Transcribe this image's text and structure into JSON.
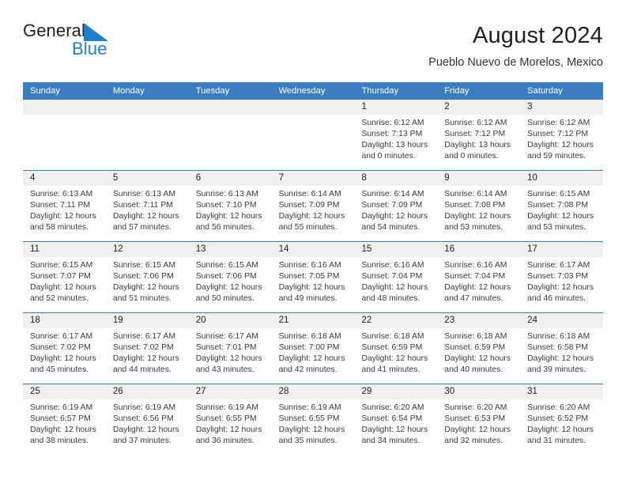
{
  "brand": {
    "name_primary": "General",
    "name_secondary": "Blue",
    "triangle_icon": "blue-triangle-logo-icon",
    "accent_color": "#1c7fd1"
  },
  "header": {
    "title": "August 2024",
    "subtitle": "Pueblo Nuevo de Morelos, Mexico"
  },
  "colors": {
    "header_blue": "#3a7dc0",
    "date_band_gray": "#f0f0f0",
    "text": "#3b3b3b"
  },
  "weekdays": [
    "Sunday",
    "Monday",
    "Tuesday",
    "Wednesday",
    "Thursday",
    "Friday",
    "Saturday"
  ],
  "weeks": [
    [
      {
        "day": "",
        "sunrise": "",
        "sunset": "",
        "daylight_1": "",
        "daylight_2": ""
      },
      {
        "day": "",
        "sunrise": "",
        "sunset": "",
        "daylight_1": "",
        "daylight_2": ""
      },
      {
        "day": "",
        "sunrise": "",
        "sunset": "",
        "daylight_1": "",
        "daylight_2": ""
      },
      {
        "day": "",
        "sunrise": "",
        "sunset": "",
        "daylight_1": "",
        "daylight_2": ""
      },
      {
        "day": "1",
        "sunrise": "Sunrise: 6:12 AM",
        "sunset": "Sunset: 7:13 PM",
        "daylight_1": "Daylight: 13 hours",
        "daylight_2": "and 0 minutes."
      },
      {
        "day": "2",
        "sunrise": "Sunrise: 6:12 AM",
        "sunset": "Sunset: 7:12 PM",
        "daylight_1": "Daylight: 13 hours",
        "daylight_2": "and 0 minutes."
      },
      {
        "day": "3",
        "sunrise": "Sunrise: 6:12 AM",
        "sunset": "Sunset: 7:12 PM",
        "daylight_1": "Daylight: 12 hours",
        "daylight_2": "and 59 minutes."
      }
    ],
    [
      {
        "day": "4",
        "sunrise": "Sunrise: 6:13 AM",
        "sunset": "Sunset: 7:11 PM",
        "daylight_1": "Daylight: 12 hours",
        "daylight_2": "and 58 minutes."
      },
      {
        "day": "5",
        "sunrise": "Sunrise: 6:13 AM",
        "sunset": "Sunset: 7:11 PM",
        "daylight_1": "Daylight: 12 hours",
        "daylight_2": "and 57 minutes."
      },
      {
        "day": "6",
        "sunrise": "Sunrise: 6:13 AM",
        "sunset": "Sunset: 7:10 PM",
        "daylight_1": "Daylight: 12 hours",
        "daylight_2": "and 56 minutes."
      },
      {
        "day": "7",
        "sunrise": "Sunrise: 6:14 AM",
        "sunset": "Sunset: 7:09 PM",
        "daylight_1": "Daylight: 12 hours",
        "daylight_2": "and 55 minutes."
      },
      {
        "day": "8",
        "sunrise": "Sunrise: 6:14 AM",
        "sunset": "Sunset: 7:09 PM",
        "daylight_1": "Daylight: 12 hours",
        "daylight_2": "and 54 minutes."
      },
      {
        "day": "9",
        "sunrise": "Sunrise: 6:14 AM",
        "sunset": "Sunset: 7:08 PM",
        "daylight_1": "Daylight: 12 hours",
        "daylight_2": "and 53 minutes."
      },
      {
        "day": "10",
        "sunrise": "Sunrise: 6:15 AM",
        "sunset": "Sunset: 7:08 PM",
        "daylight_1": "Daylight: 12 hours",
        "daylight_2": "and 53 minutes."
      }
    ],
    [
      {
        "day": "11",
        "sunrise": "Sunrise: 6:15 AM",
        "sunset": "Sunset: 7:07 PM",
        "daylight_1": "Daylight: 12 hours",
        "daylight_2": "and 52 minutes."
      },
      {
        "day": "12",
        "sunrise": "Sunrise: 6:15 AM",
        "sunset": "Sunset: 7:06 PM",
        "daylight_1": "Daylight: 12 hours",
        "daylight_2": "and 51 minutes."
      },
      {
        "day": "13",
        "sunrise": "Sunrise: 6:15 AM",
        "sunset": "Sunset: 7:06 PM",
        "daylight_1": "Daylight: 12 hours",
        "daylight_2": "and 50 minutes."
      },
      {
        "day": "14",
        "sunrise": "Sunrise: 6:16 AM",
        "sunset": "Sunset: 7:05 PM",
        "daylight_1": "Daylight: 12 hours",
        "daylight_2": "and 49 minutes."
      },
      {
        "day": "15",
        "sunrise": "Sunrise: 6:16 AM",
        "sunset": "Sunset: 7:04 PM",
        "daylight_1": "Daylight: 12 hours",
        "daylight_2": "and 48 minutes."
      },
      {
        "day": "16",
        "sunrise": "Sunrise: 6:16 AM",
        "sunset": "Sunset: 7:04 PM",
        "daylight_1": "Daylight: 12 hours",
        "daylight_2": "and 47 minutes."
      },
      {
        "day": "17",
        "sunrise": "Sunrise: 6:17 AM",
        "sunset": "Sunset: 7:03 PM",
        "daylight_1": "Daylight: 12 hours",
        "daylight_2": "and 46 minutes."
      }
    ],
    [
      {
        "day": "18",
        "sunrise": "Sunrise: 6:17 AM",
        "sunset": "Sunset: 7:02 PM",
        "daylight_1": "Daylight: 12 hours",
        "daylight_2": "and 45 minutes."
      },
      {
        "day": "19",
        "sunrise": "Sunrise: 6:17 AM",
        "sunset": "Sunset: 7:02 PM",
        "daylight_1": "Daylight: 12 hours",
        "daylight_2": "and 44 minutes."
      },
      {
        "day": "20",
        "sunrise": "Sunrise: 6:17 AM",
        "sunset": "Sunset: 7:01 PM",
        "daylight_1": "Daylight: 12 hours",
        "daylight_2": "and 43 minutes."
      },
      {
        "day": "21",
        "sunrise": "Sunrise: 6:18 AM",
        "sunset": "Sunset: 7:00 PM",
        "daylight_1": "Daylight: 12 hours",
        "daylight_2": "and 42 minutes."
      },
      {
        "day": "22",
        "sunrise": "Sunrise: 6:18 AM",
        "sunset": "Sunset: 6:59 PM",
        "daylight_1": "Daylight: 12 hours",
        "daylight_2": "and 41 minutes."
      },
      {
        "day": "23",
        "sunrise": "Sunrise: 6:18 AM",
        "sunset": "Sunset: 6:59 PM",
        "daylight_1": "Daylight: 12 hours",
        "daylight_2": "and 40 minutes."
      },
      {
        "day": "24",
        "sunrise": "Sunrise: 6:18 AM",
        "sunset": "Sunset: 6:58 PM",
        "daylight_1": "Daylight: 12 hours",
        "daylight_2": "and 39 minutes."
      }
    ],
    [
      {
        "day": "25",
        "sunrise": "Sunrise: 6:19 AM",
        "sunset": "Sunset: 6:57 PM",
        "daylight_1": "Daylight: 12 hours",
        "daylight_2": "and 38 minutes."
      },
      {
        "day": "26",
        "sunrise": "Sunrise: 6:19 AM",
        "sunset": "Sunset: 6:56 PM",
        "daylight_1": "Daylight: 12 hours",
        "daylight_2": "and 37 minutes."
      },
      {
        "day": "27",
        "sunrise": "Sunrise: 6:19 AM",
        "sunset": "Sunset: 6:55 PM",
        "daylight_1": "Daylight: 12 hours",
        "daylight_2": "and 36 minutes."
      },
      {
        "day": "28",
        "sunrise": "Sunrise: 6:19 AM",
        "sunset": "Sunset: 6:55 PM",
        "daylight_1": "Daylight: 12 hours",
        "daylight_2": "and 35 minutes."
      },
      {
        "day": "29",
        "sunrise": "Sunrise: 6:20 AM",
        "sunset": "Sunset: 6:54 PM",
        "daylight_1": "Daylight: 12 hours",
        "daylight_2": "and 34 minutes."
      },
      {
        "day": "30",
        "sunrise": "Sunrise: 6:20 AM",
        "sunset": "Sunset: 6:53 PM",
        "daylight_1": "Daylight: 12 hours",
        "daylight_2": "and 32 minutes."
      },
      {
        "day": "31",
        "sunrise": "Sunrise: 6:20 AM",
        "sunset": "Sunset: 6:52 PM",
        "daylight_1": "Daylight: 12 hours",
        "daylight_2": "and 31 minutes."
      }
    ]
  ]
}
